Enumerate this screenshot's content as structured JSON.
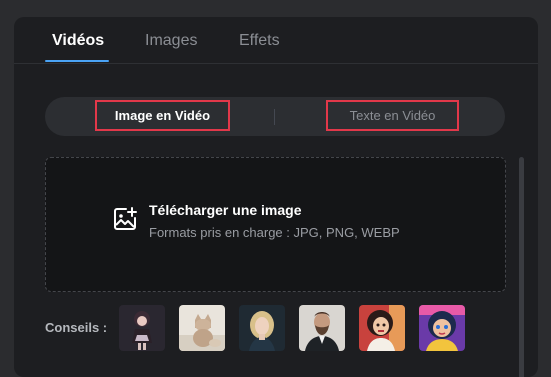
{
  "tabs": [
    {
      "label": "Vidéos",
      "active": true
    },
    {
      "label": "Images",
      "active": false
    },
    {
      "label": "Effets",
      "active": false
    }
  ],
  "mode_switch": {
    "image_to_video": "Image en Vidéo",
    "text_to_video": "Texte en Vidéo",
    "selected": "Image en Vidéo"
  },
  "upload": {
    "icon": "image-upload-icon",
    "title": "Télécharger une image",
    "formats": "Formats pris en charge : JPG, PNG, WEBP"
  },
  "tips": {
    "label": "Conseils :",
    "thumbnails": [
      {
        "name": "anime-girl-thumbnail"
      },
      {
        "name": "cat-thumbnail"
      },
      {
        "name": "blonde-woman-thumbnail"
      },
      {
        "name": "bearded-man-thumbnail"
      },
      {
        "name": "cartoon-woman-thumbnail"
      },
      {
        "name": "cartoon-girl-thumbnail"
      }
    ]
  },
  "colors": {
    "accent_underline": "#4aa3f5",
    "highlight_border": "#e2384a",
    "panel_bg": "#1d1e21"
  }
}
